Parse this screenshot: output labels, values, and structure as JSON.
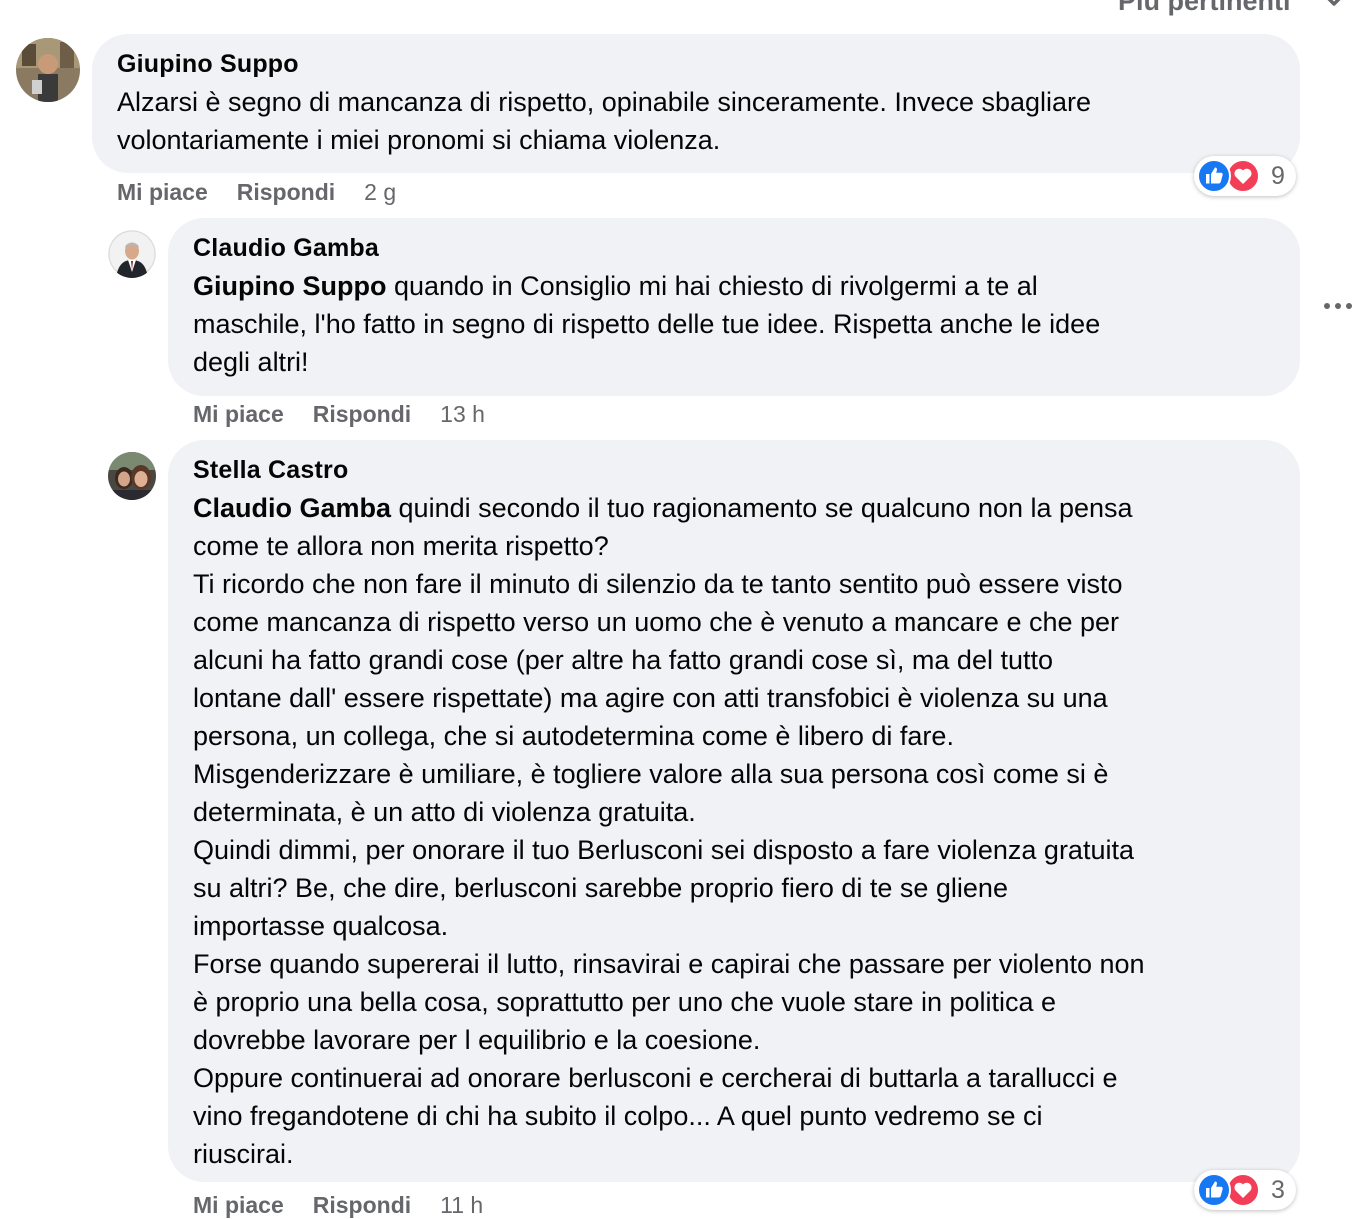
{
  "sort": {
    "label": "Più pertinenti"
  },
  "comments": [
    {
      "author": "Giupino Suppo",
      "mention": "",
      "text": "Alzarsi è segno di mancanza di rispetto, opinabile sinceramente. Invece sbagliare\nvolontariamente i miei pronomi si chiama violenza.",
      "like": "Mi piace",
      "reply": "Rispondi",
      "time": "2 g",
      "reaction_count": "9"
    },
    {
      "author": "Claudio Gamba",
      "mention": "Giupino Suppo",
      "text": " quando in Consiglio mi hai chiesto di rivolgermi a te al\nmaschile, l'ho fatto in segno di rispetto delle tue idee. Rispetta anche le idee\ndegli altri!",
      "like": "Mi piace",
      "reply": "Rispondi",
      "time": "13 h"
    },
    {
      "author": "Stella Castro",
      "mention": "Claudio Gamba",
      "text": " quindi secondo il tuo ragionamento se qualcuno non la pensa\ncome te allora non merita rispetto?\nTi ricordo che non fare il minuto di silenzio da te tanto sentito può essere visto\ncome mancanza di rispetto verso un uomo che è venuto a mancare e che per\nalcuni ha fatto grandi cose (per altre ha fatto grandi cose sì, ma del tutto\nlontane dall' essere rispettate) ma agire con atti transfobici è violenza su una\npersona, un collega, che si autodetermina come è libero di fare.\nMisgenderizzare è umiliare, è togliere valore alla sua persona così come si è\ndeterminata, è un atto di violenza gratuita.\nQuindi dimmi, per onorare il tuo Berlusconi sei disposto a fare violenza gratuita\nsu altri? Be, che dire, berlusconi sarebbe proprio fiero di te se gliene\nimportasse qualcosa.\nForse quando supererai il lutto, rinsavirai e capirai che passare per violento non\nè proprio una bella cosa, soprattutto per uno che vuole stare in politica e\ndovrebbe lavorare per l equilibrio e la coesione.\nOppure continuerai ad onorare berlusconi e cercherai di buttarla a tarallucci e\nvino fregandotene di chi ha subito il colpo... A quel punto vedremo se ci\nriuscirai.",
      "like": "Mi piace",
      "reply": "Rispondi",
      "time": "11 h",
      "reaction_count": "3"
    }
  ],
  "icons": {
    "like": "like-reaction-icon",
    "love": "love-reaction-icon",
    "more": "more-options-icon",
    "sort": "chevron-down-icon"
  },
  "colors": {
    "like_blue": "#1877f2",
    "love_red": "#f33e58",
    "bubble_bg": "#f0f2f5",
    "meta_gray": "#65676b"
  }
}
